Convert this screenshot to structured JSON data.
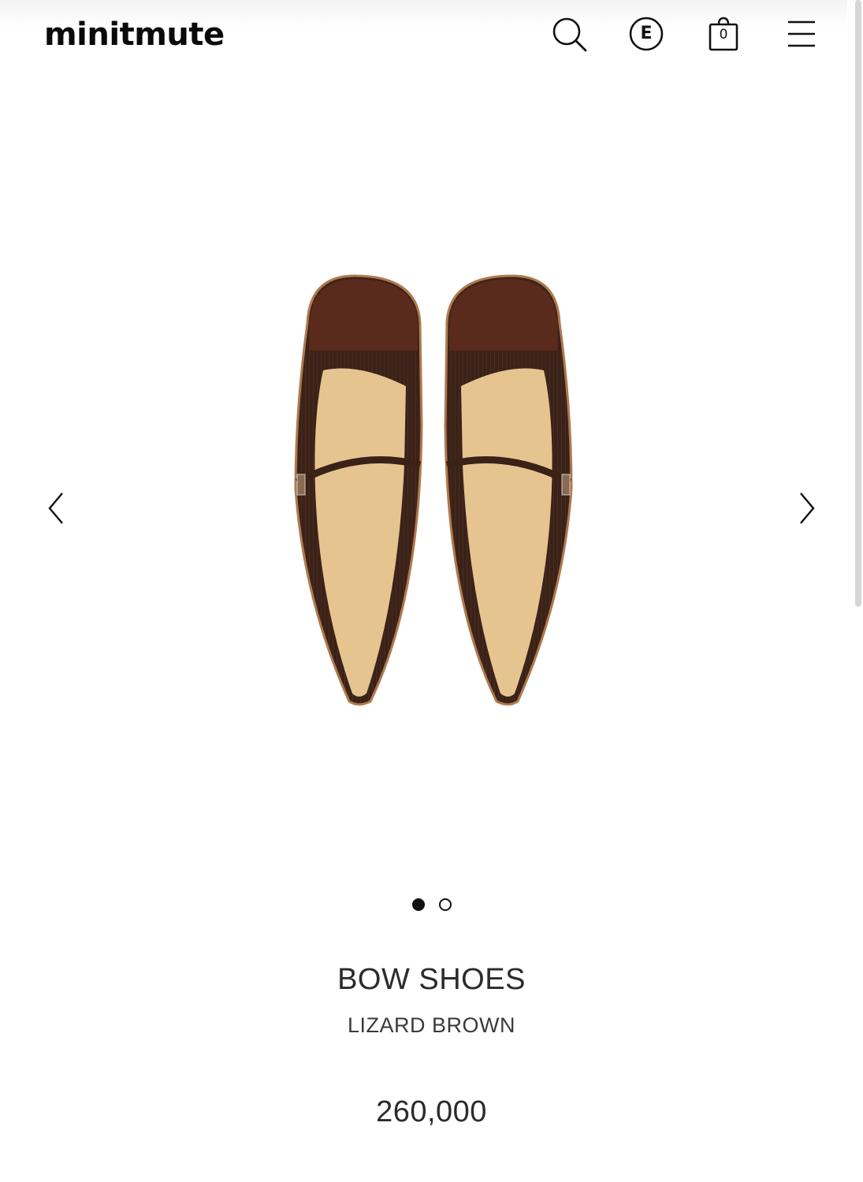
{
  "header": {
    "logo": "minitmute",
    "language_label": "E",
    "cart_count": "0"
  },
  "icons": {
    "search": "search-icon",
    "language": "language-icon",
    "cart": "shopping-bag-icon",
    "menu": "hamburger-menu-icon",
    "prev": "chevron-left-icon",
    "next": "chevron-right-icon"
  },
  "gallery": {
    "slide_count": 2,
    "active_slide": 1
  },
  "product": {
    "name": "BOW SHOES",
    "color": "LIZARD BROWN",
    "price": "260,000"
  },
  "colors": {
    "text": "#2b2b2b",
    "shoe_upper": "#3a2218",
    "shoe_toe": "#5a2a1c",
    "insole": "#e6c48f",
    "welt": "#b07a4e"
  }
}
